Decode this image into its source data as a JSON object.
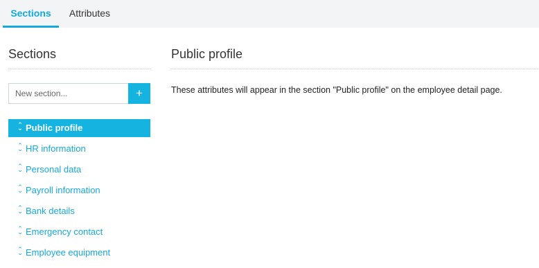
{
  "tabs": {
    "sections_label": "Sections",
    "attributes_label": "Attributes",
    "active": "Sections"
  },
  "sidebar": {
    "title": "Sections",
    "new_section_placeholder": "New section...",
    "add_button_label": "+",
    "items": [
      {
        "label": "Public profile",
        "active": true
      },
      {
        "label": "HR information",
        "active": false
      },
      {
        "label": "Personal data",
        "active": false
      },
      {
        "label": "Payroll information",
        "active": false
      },
      {
        "label": "Bank details",
        "active": false
      },
      {
        "label": "Emergency contact",
        "active": false
      },
      {
        "label": "Employee equipment",
        "active": false
      }
    ]
  },
  "main": {
    "title": "Public profile",
    "description": "These attributes will appear in the section \"Public profile\" on the employee detail page."
  },
  "icons": {
    "item_handle": "drag-handle-icon",
    "add": "plus-icon"
  },
  "colors": {
    "accent": "#14b3e0",
    "link": "#14a9d8",
    "tabbar_bg": "#f3f4f6"
  }
}
